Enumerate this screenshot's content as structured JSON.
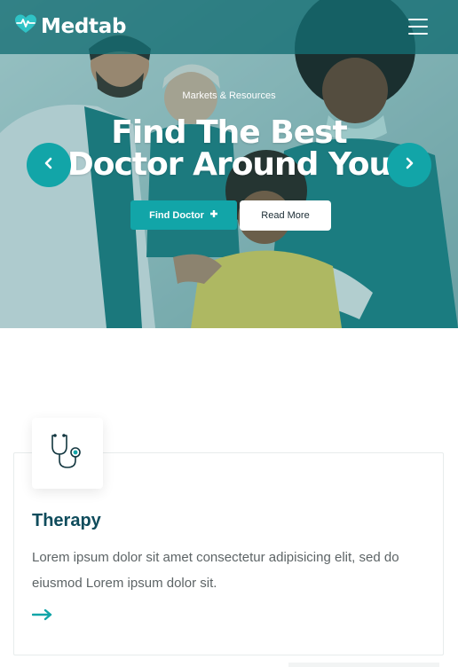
{
  "header": {
    "brand": "Medtab",
    "logo_icon": "heart-pulse-icon",
    "menu_icon": "hamburger-menu-icon"
  },
  "hero": {
    "kicker": "Markets & Resources",
    "headline_line1": "Find The Best",
    "headline_line2": "Doctor Around You",
    "primary_button": "Find Doctor",
    "primary_button_icon": "plus-icon",
    "secondary_button": "Read More",
    "prev_icon": "chevron-left-icon",
    "next_icon": "chevron-right-icon",
    "image": "doctors-with-child-photo"
  },
  "service_card": {
    "icon": "stethoscope-icon",
    "title": "Therapy",
    "text": "Lorem ipsum dolor sit amet consectetur adipisicing elit, sed do eiusmod Lorem ipsum dolor sit.",
    "link_icon": "arrow-right-icon"
  },
  "colors": {
    "accent": "#12a5a8",
    "header_overlay": "#146e73",
    "title": "#0f4c5c",
    "body_text": "#5d6466"
  }
}
